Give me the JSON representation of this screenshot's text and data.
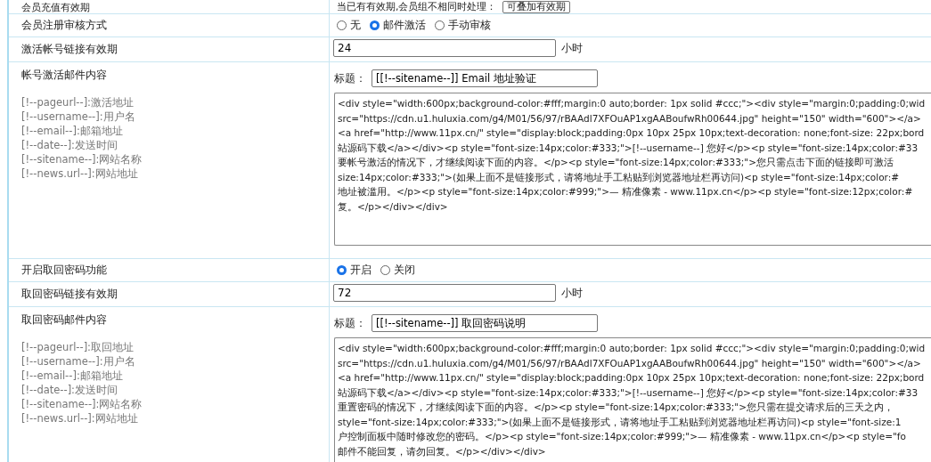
{
  "rows": [
    {
      "kind": "select",
      "label": "会员充值有效期",
      "prompt": "当已有有效期,会员组不相同时处理：",
      "select": "可叠加有效期"
    },
    {
      "kind": "radio",
      "label": "会员注册审核方式",
      "options": [
        {
          "label": "无",
          "selected": false
        },
        {
          "label": "邮件激活",
          "selected": true
        },
        {
          "label": "手动审核",
          "selected": false
        }
      ]
    },
    {
      "kind": "number",
      "label": "激活帐号链接有效期",
      "value": "24",
      "unit": "小时"
    },
    {
      "kind": "email",
      "label": "帐号激活邮件内容",
      "variables": [
        "[!--pageurl--]:激活地址",
        "[!--username--]:用户名",
        "[!--email--]:邮箱地址",
        "[!--date--]:发送时间",
        "[!--sitename--]:网站名称",
        "[!--news.url--]:网站地址"
      ],
      "subject_label": "标题：",
      "subject": "[[!--sitename--]] Email 地址验证",
      "body_lines": [
        "<div style=\"width:600px;background-color:#fff;margin:0 auto;border: 1px solid #ccc;\"><div style=\"margin:0;padding:0;wid",
        "src=\"https://cdn.u1.huluxia.com/g4/M01/56/97/rBAAdl7XFOuAP1xgAABoufwRh00644.jpg\" height=\"150\" width=\"600\"></a>",
        "<a href=\"http://www.11px.cn/\" style=\"display:block;padding:0px 10px 25px 10px;text-decoration: none;font-size: 22px;bord",
        "站源码下载</a></div><p style=\"font-size:14px;color:#333;\">[!--username--] 您好</p><p style=\"font-size:14px;color:#33",
        "要帐号激活的情况下，才继续阅读下面的内容。</p><p style=\"font-size:14px;color:#333;\">您只需点击下面的链接即可激活",
        "size:14px;color:#333;\">(如果上面不是链接形式，请将地址手工粘贴到浏览器地址栏再访问)<p style=\"font-size:14px;color:#",
        "地址被滥用。</p><p style=\"font-size:14px;color:#999;\">— 精准像素 - www.11px.cn</p><p style=\"font-size:12px;color:#",
        "复。</p></div></div>"
      ]
    },
    {
      "kind": "radio",
      "label": "开启取回密码功能",
      "options": [
        {
          "label": "开启",
          "selected": true
        },
        {
          "label": "关闭",
          "selected": false
        }
      ]
    },
    {
      "kind": "number",
      "label": "取回密码链接有效期",
      "value": "72",
      "unit": "小时"
    },
    {
      "kind": "email",
      "label": "取回密码邮件内容",
      "variables": [
        "[!--pageurl--]:取回地址",
        "[!--username--]:用户名",
        "[!--email--]:邮箱地址",
        "[!--date--]:发送时间",
        "[!--sitename--]:网站名称",
        "[!--news.url--]:网站地址"
      ],
      "subject_label": "标题：",
      "subject": "[[!--sitename--]] 取回密码说明",
      "body_lines": [
        "<div style=\"width:600px;background-color:#fff;margin:0 auto;border: 1px solid #ccc;\"><div style=\"margin:0;padding:0;wid",
        "src=\"https://cdn.u1.huluxia.com/g4/M01/56/97/rBAAdl7XFOuAP1xgAABoufwRh00644.jpg\" height=\"150\" width=\"600\"></a>",
        "<a href=\"http://www.11px.cn/\" style=\"display:block;padding:0px 10px 25px 10px;text-decoration: none;font-size: 22px;bord",
        "站源码下载</a></div><p style=\"font-size:14px;color:#333;\">[!--username--] 您好</p><p style=\"font-size:14px;color:#33",
        "重置密码的情况下，才继续阅读下面的内容。</p><p style=\"font-size:14px;color:#333;\">您只需在提交请求后的三天之内，",
        "style=\"font-size:14px;color:#333;\">(如果上面不是链接形式，请将地址手工粘贴到浏览器地址栏再访问)<p style=\"font-size:1",
        "户控制面板中随时修改您的密码。</p><p style=\"font-size:14px;color:#999;\">— 精准像素 - www.11px.cn</p><p style=\"fo",
        "邮件不能回复，请勿回复。</p></div></div>"
      ]
    }
  ]
}
